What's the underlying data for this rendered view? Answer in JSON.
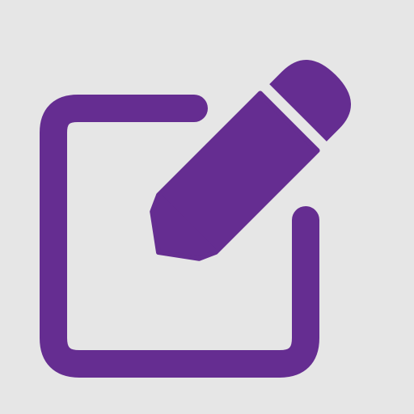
{
  "icon": {
    "name": "edit-icon",
    "color": "#652d91",
    "background": "#e6e6e6"
  }
}
